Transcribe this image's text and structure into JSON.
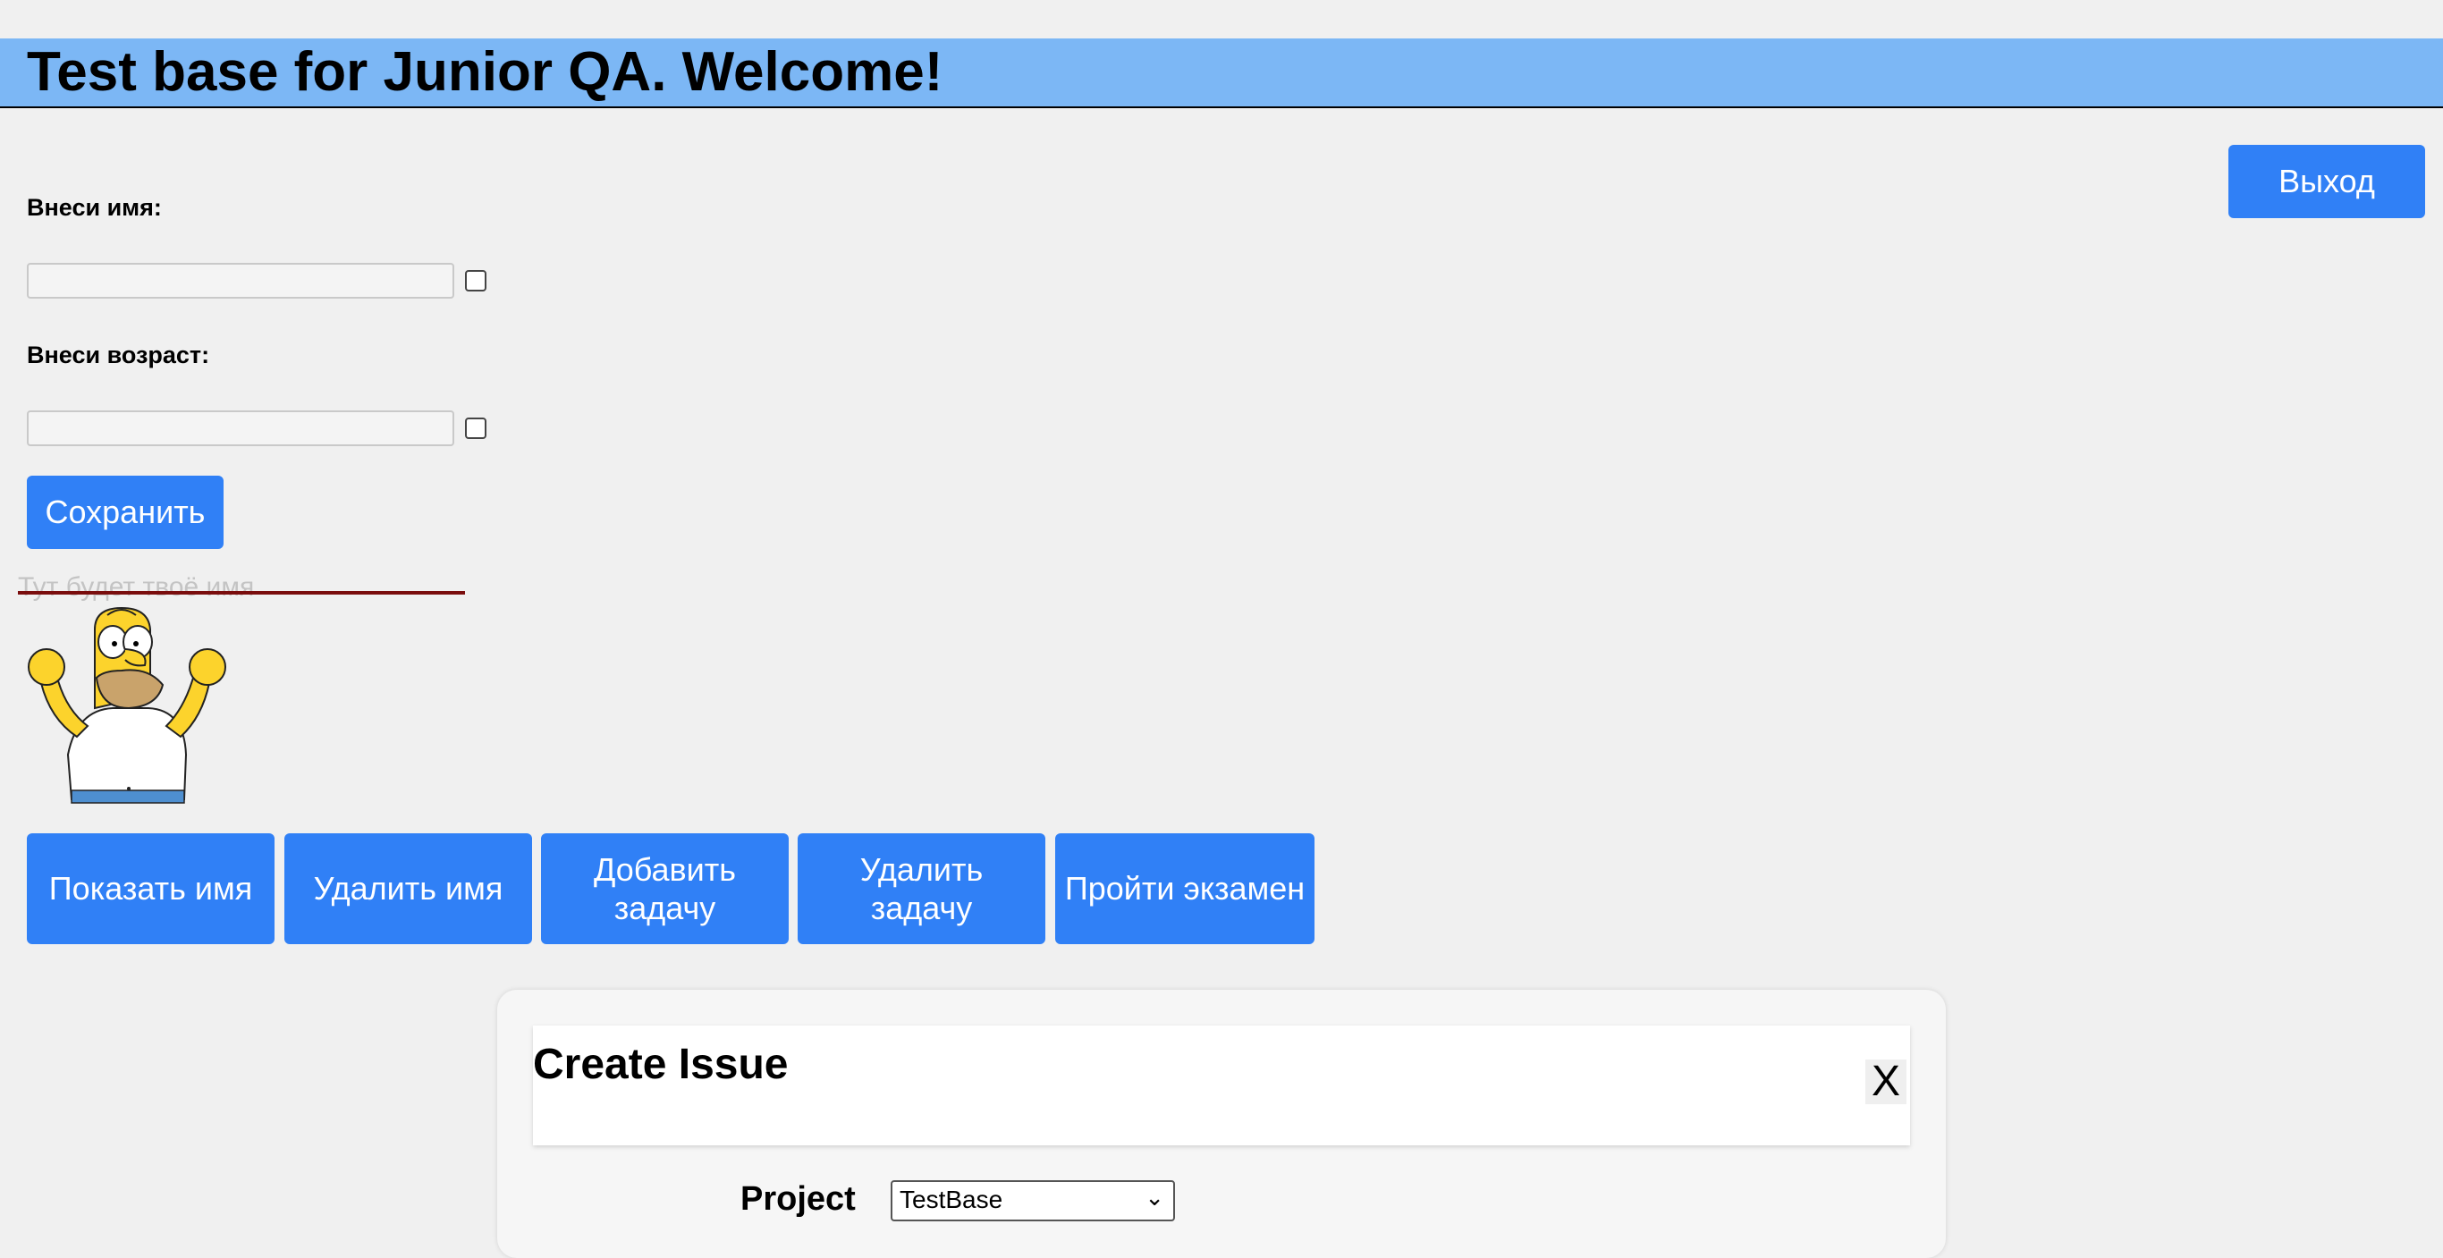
{
  "header": {
    "title": "Test base for Junior QA. Welcome!"
  },
  "logout_label": "Выход",
  "form": {
    "name_label": "Внеси имя:",
    "name_value": "",
    "age_label": "Внеси возраст:",
    "age_value": "",
    "save_label": "Сохранить"
  },
  "name_display_placeholder": "Тут будет твоё имя",
  "actions": [
    {
      "label": "Показать имя"
    },
    {
      "label": "Удалить имя"
    },
    {
      "label": "Добавить задачу"
    },
    {
      "label": "Удалить задачу"
    },
    {
      "label": "Пройти экзамен"
    }
  ],
  "modal": {
    "title": "Create Issue",
    "close_label": "X",
    "project_label": "Project",
    "project_selected": "TestBase"
  },
  "colors": {
    "header_bg": "#7cb7f5",
    "button_bg": "#3080f6",
    "strike_line": "#7a0d0d"
  }
}
